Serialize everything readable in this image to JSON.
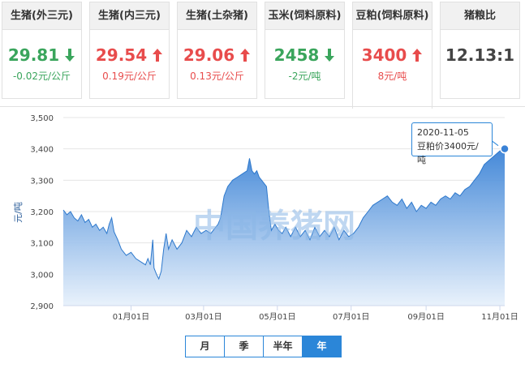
{
  "cards": [
    {
      "title": "生猪(外三元)",
      "price": "29.81",
      "direction": "down",
      "change": "-0.02元/公斤"
    },
    {
      "title": "生猪(内三元)",
      "price": "29.54",
      "direction": "up",
      "change": "0.19元/公斤"
    },
    {
      "title": "生猪(土杂猪)",
      "price": "29.06",
      "direction": "up",
      "change": "0.13元/公斤"
    },
    {
      "title": "玉米(饲料原料)",
      "price": "2458",
      "direction": "down",
      "change": "-2元/吨"
    },
    {
      "title": "豆粕(饲料原料)",
      "price": "3400",
      "direction": "up",
      "change": "8元/吨"
    },
    {
      "title": "猪粮比",
      "price": "12.13:1",
      "direction": "none",
      "change": ""
    }
  ],
  "colors": {
    "up": "#e84c4c",
    "down": "#3aa55c",
    "accent": "#2b86d8",
    "area_top": "#4a8fdc",
    "area_bottom": "#e9f2fc"
  },
  "tooltip": {
    "date": "2020-11-05",
    "text": "豆粕价3400元/吨"
  },
  "watermark": "中国养猪网",
  "range_buttons": [
    "月",
    "季",
    "半年",
    "年"
  ],
  "selected_range": "年",
  "chart_data": {
    "type": "area",
    "ylabel": "元/吨",
    "ylim": [
      2900,
      3500
    ],
    "yticks": [
      "2,900",
      "3,000",
      "3,100",
      "3,200",
      "3,300",
      "3,400",
      "3,500"
    ],
    "ytick_values": [
      2900,
      3000,
      3100,
      3200,
      3300,
      3400,
      3500
    ],
    "xticks": [
      "01月01日",
      "03月01日",
      "05月01日",
      "07月01日",
      "09月01日",
      "11月01日"
    ],
    "xtick_days": [
      56,
      116,
      177,
      238,
      300,
      361
    ],
    "x_start": "2019-11-06",
    "grid": true,
    "series": [
      {
        "points": [
          [
            0,
            3205
          ],
          [
            3,
            3190
          ],
          [
            6,
            3200
          ],
          [
            9,
            3180
          ],
          [
            12,
            3170
          ],
          [
            15,
            3190
          ],
          [
            18,
            3165
          ],
          [
            21,
            3175
          ],
          [
            24,
            3150
          ],
          [
            27,
            3160
          ],
          [
            30,
            3140
          ],
          [
            33,
            3150
          ],
          [
            36,
            3130
          ],
          [
            38,
            3160
          ],
          [
            40,
            3180
          ],
          [
            42,
            3135
          ],
          [
            45,
            3110
          ],
          [
            48,
            3080
          ],
          [
            52,
            3060
          ],
          [
            56,
            3070
          ],
          [
            60,
            3050
          ],
          [
            64,
            3040
          ],
          [
            68,
            3030
          ],
          [
            70,
            3050
          ],
          [
            72,
            3030
          ],
          [
            74,
            3110
          ],
          [
            75,
            3020
          ],
          [
            77,
            3000
          ],
          [
            79,
            2985
          ],
          [
            81,
            3010
          ],
          [
            83,
            3080
          ],
          [
            85,
            3130
          ],
          [
            87,
            3080
          ],
          [
            90,
            3110
          ],
          [
            94,
            3080
          ],
          [
            98,
            3100
          ],
          [
            102,
            3140
          ],
          [
            106,
            3120
          ],
          [
            110,
            3150
          ],
          [
            114,
            3130
          ],
          [
            118,
            3140
          ],
          [
            122,
            3130
          ],
          [
            126,
            3150
          ],
          [
            128,
            3160
          ],
          [
            130,
            3180
          ],
          [
            133,
            3250
          ],
          [
            136,
            3280
          ],
          [
            140,
            3300
          ],
          [
            144,
            3310
          ],
          [
            148,
            3320
          ],
          [
            152,
            3330
          ],
          [
            154,
            3370
          ],
          [
            156,
            3330
          ],
          [
            158,
            3320
          ],
          [
            160,
            3330
          ],
          [
            162,
            3310
          ],
          [
            164,
            3300
          ],
          [
            166,
            3290
          ],
          [
            168,
            3280
          ],
          [
            170,
            3200
          ],
          [
            172,
            3140
          ],
          [
            175,
            3160
          ],
          [
            178,
            3140
          ],
          [
            181,
            3130
          ],
          [
            184,
            3150
          ],
          [
            188,
            3120
          ],
          [
            192,
            3150
          ],
          [
            196,
            3120
          ],
          [
            200,
            3140
          ],
          [
            204,
            3110
          ],
          [
            208,
            3150
          ],
          [
            212,
            3120
          ],
          [
            216,
            3140
          ],
          [
            220,
            3120
          ],
          [
            224,
            3150
          ],
          [
            228,
            3110
          ],
          [
            232,
            3140
          ],
          [
            236,
            3120
          ],
          [
            240,
            3130
          ],
          [
            244,
            3150
          ],
          [
            248,
            3180
          ],
          [
            252,
            3200
          ],
          [
            256,
            3220
          ],
          [
            260,
            3230
          ],
          [
            264,
            3240
          ],
          [
            268,
            3250
          ],
          [
            272,
            3230
          ],
          [
            276,
            3220
          ],
          [
            280,
            3240
          ],
          [
            284,
            3210
          ],
          [
            288,
            3230
          ],
          [
            292,
            3200
          ],
          [
            296,
            3220
          ],
          [
            300,
            3210
          ],
          [
            304,
            3230
          ],
          [
            308,
            3220
          ],
          [
            312,
            3240
          ],
          [
            316,
            3250
          ],
          [
            320,
            3240
          ],
          [
            324,
            3260
          ],
          [
            328,
            3250
          ],
          [
            332,
            3270
          ],
          [
            336,
            3280
          ],
          [
            340,
            3300
          ],
          [
            344,
            3320
          ],
          [
            348,
            3350
          ],
          [
            351,
            3360
          ],
          [
            354,
            3370
          ],
          [
            357,
            3380
          ],
          [
            360,
            3390
          ],
          [
            363,
            3400
          ],
          [
            365,
            3400
          ]
        ]
      }
    ]
  }
}
